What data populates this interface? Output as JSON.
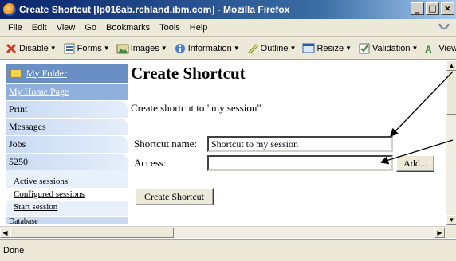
{
  "window": {
    "title": "Create Shortcut [lp016ab.rchland.ibm.com] - Mozilla Firefox",
    "minimize": "_",
    "maximize": "□",
    "close": "×"
  },
  "menu": {
    "items": [
      {
        "label": "File"
      },
      {
        "label": "Edit"
      },
      {
        "label": "View"
      },
      {
        "label": "Go"
      },
      {
        "label": "Bookmarks"
      },
      {
        "label": "Tools"
      },
      {
        "label": "Help"
      }
    ]
  },
  "toolbar": {
    "items": [
      {
        "label": "Disable",
        "icon": "disable-icon"
      },
      {
        "label": "Forms",
        "icon": "forms-icon"
      },
      {
        "label": "Images",
        "icon": "images-icon"
      },
      {
        "label": "Information",
        "icon": "information-icon"
      },
      {
        "label": "Outline",
        "icon": "outline-icon"
      },
      {
        "label": "Resize",
        "icon": "resize-icon"
      },
      {
        "label": "Validation",
        "icon": "validation-icon"
      },
      {
        "label": "View",
        "icon": "view-source-icon"
      }
    ]
  },
  "sidebar": {
    "folder": "My Folder",
    "home": "My Home Page",
    "items": [
      {
        "label": "Print"
      },
      {
        "label": "Messages"
      },
      {
        "label": "Jobs"
      },
      {
        "label": "5250"
      }
    ],
    "sub_items": [
      {
        "label": "Active sessions"
      },
      {
        "label": "Configured sessions"
      },
      {
        "label": "Start session"
      }
    ],
    "partial": "Database"
  },
  "main": {
    "title": "Create Shortcut",
    "description": "Create shortcut to \"my session\"",
    "shortcut_name_label": "Shortcut name:",
    "shortcut_name_value": "Shortcut to my session",
    "access_label": "Access:",
    "access_value": "",
    "add_button": "Add...",
    "create_button": "Create Shortcut"
  },
  "status": {
    "text": "Done"
  },
  "colors": {
    "titlebar": "#0a246a",
    "sidebar_header": "#6a8fc4",
    "sidebar_nav": "#c9daf2",
    "chrome": "#ece9d8"
  }
}
